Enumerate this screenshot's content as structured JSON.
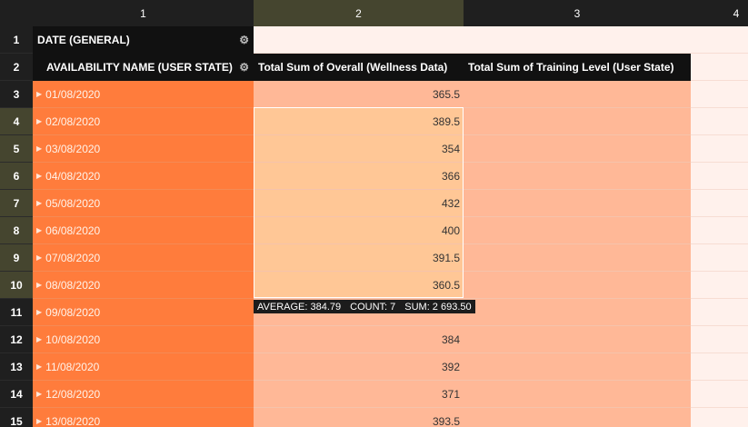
{
  "column_headers": [
    "1",
    "2",
    "3",
    "4"
  ],
  "pivot": {
    "date_field_label": "DATE (GENERAL)",
    "row_field_label": "AVAILABILITY NAME (USER STATE)",
    "value_headers": [
      "Total Sum of Overall (Wellness Data)",
      "Total Sum of Training Level (User State)"
    ]
  },
  "rows": [
    {
      "num": "3",
      "date": "01/08/2020",
      "overall": "365.5"
    },
    {
      "num": "4",
      "date": "02/08/2020",
      "overall": "389.5"
    },
    {
      "num": "5",
      "date": "03/08/2020",
      "overall": "354"
    },
    {
      "num": "6",
      "date": "04/08/2020",
      "overall": "366"
    },
    {
      "num": "7",
      "date": "05/08/2020",
      "overall": "432"
    },
    {
      "num": "8",
      "date": "06/08/2020",
      "overall": "400"
    },
    {
      "num": "9",
      "date": "07/08/2020",
      "overall": "391.5"
    },
    {
      "num": "10",
      "date": "08/08/2020",
      "overall": "360.5"
    },
    {
      "num": "11",
      "date": "09/08/2020",
      "overall": ""
    },
    {
      "num": "12",
      "date": "10/08/2020",
      "overall": "384"
    },
    {
      "num": "13",
      "date": "11/08/2020",
      "overall": "392"
    },
    {
      "num": "14",
      "date": "12/08/2020",
      "overall": "371"
    },
    {
      "num": "15",
      "date": "13/08/2020",
      "overall": "393.5"
    }
  ],
  "header_row_numbers": [
    "1",
    "2"
  ],
  "selection_stats": {
    "average": "AVERAGE: 384.79",
    "count": "COUNT: 7",
    "sum": "SUM: 2 693.50"
  },
  "colors": {
    "header_bg": "#1f1f1f",
    "active_header_bg": "#45452f",
    "date_cell_bg": "#ff7c3c",
    "value_cell_bg": "#ffb897",
    "selected_cell_bg": "#ffc796",
    "sheet_bg": "#fff1ec"
  },
  "icons": {
    "settings": "gear-icon",
    "expand": "triangle-right-icon"
  }
}
